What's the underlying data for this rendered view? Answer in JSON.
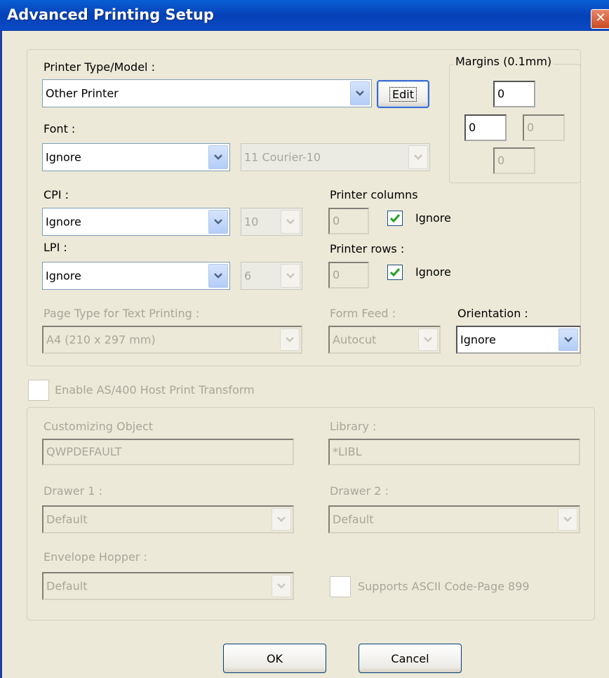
{
  "window": {
    "title": "Advanced Printing Setup",
    "close_glyph": "✕"
  },
  "printer": {
    "type_label": "Printer Type/Model :",
    "type_value": "Other Printer",
    "edit_label": "Edit",
    "font_label": "Font :",
    "font_value": "Ignore",
    "font_sub_value": "11 Courier-10",
    "cpi_label": "CPI :",
    "cpi_value": "Ignore",
    "cpi_sub_value": "10",
    "lpi_label": "LPI :",
    "lpi_value": "Ignore",
    "lpi_sub_value": "6",
    "columns_label": "Printer columns",
    "columns_value": "0",
    "columns_ignore_label": "Ignore",
    "columns_ignore_checked": true,
    "rows_label": "Printer rows :",
    "rows_value": "0",
    "rows_ignore_label": "Ignore",
    "rows_ignore_checked": true,
    "page_type_label": "Page Type for Text Printing :",
    "page_type_value": "A4 (210 x 297 mm)",
    "form_feed_label": "Form Feed :",
    "form_feed_value": "Autocut",
    "orientation_label": "Orientation :",
    "orientation_value": "Ignore"
  },
  "margins": {
    "label": "Margins (0.1mm)",
    "top": "0",
    "left": "0",
    "right": "0",
    "bottom": "0"
  },
  "as400": {
    "enable_label": "Enable AS/400 Host Print Transform",
    "enable_checked": false,
    "customizing_label": "Customizing Object",
    "customizing_value": "QWPDEFAULT",
    "library_label": "Library :",
    "library_value": "*LIBL",
    "drawer1_label": "Drawer 1 :",
    "drawer1_value": "Default",
    "drawer2_label": "Drawer 2 :",
    "drawer2_value": "Default",
    "envelope_label": "Envelope Hopper :",
    "envelope_value": "Default",
    "ascii_label": "Supports ASCII Code-Page 899",
    "ascii_checked": false
  },
  "buttons": {
    "ok": "OK",
    "cancel": "Cancel"
  },
  "colors": {
    "titlebar": "#0541b8",
    "dialog_bg": "#ece9d8",
    "check_mark": "#21a121",
    "disabled_text": "#a7a69a"
  }
}
